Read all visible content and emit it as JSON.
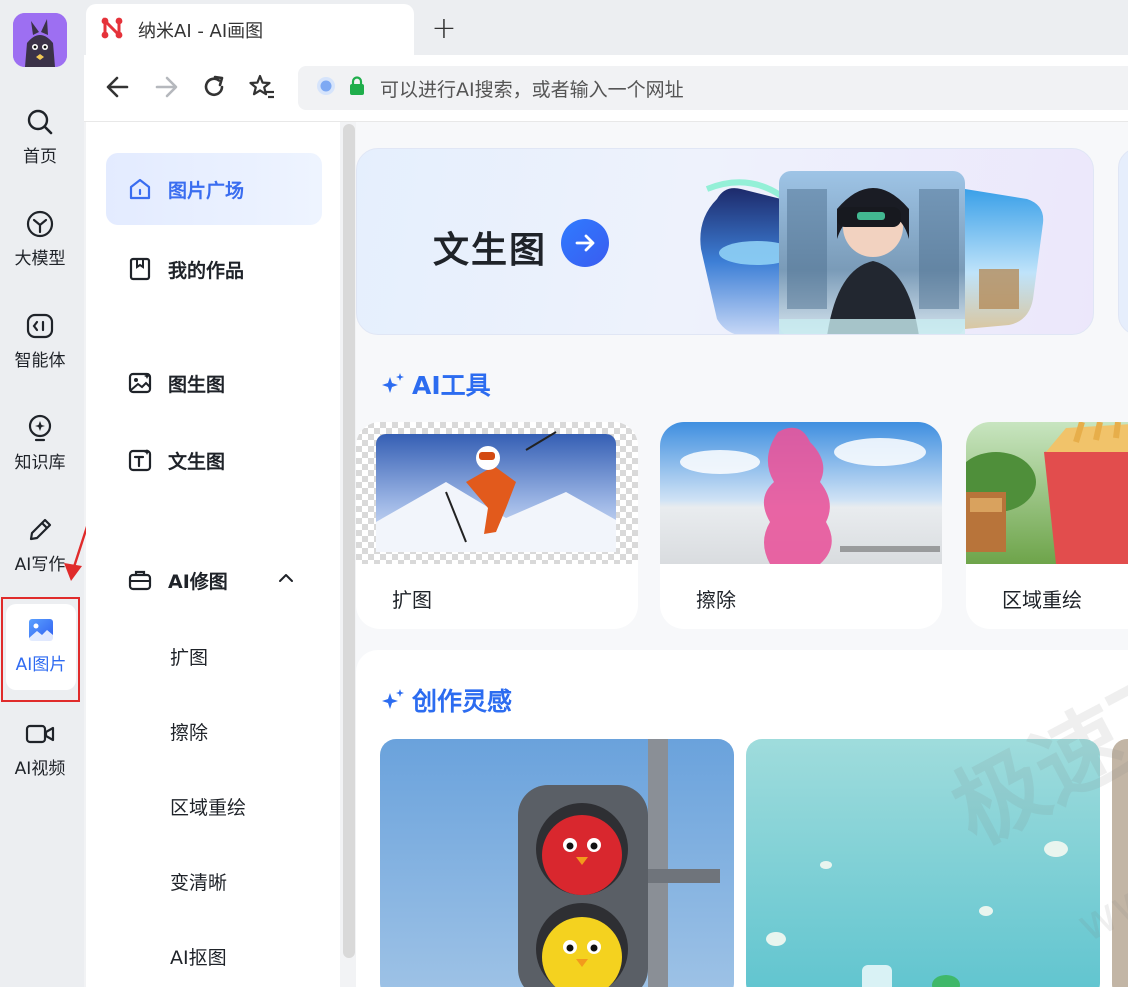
{
  "rail": {
    "items": [
      {
        "label": "首页",
        "icon": "search-icon"
      },
      {
        "label": "大模型",
        "icon": "hexagon-icon"
      },
      {
        "label": "智能体",
        "icon": "agent-icon"
      },
      {
        "label": "知识库",
        "icon": "bulb-icon"
      },
      {
        "label": "AI写作",
        "icon": "pencil-icon"
      },
      {
        "label": "AI图片",
        "icon": "image-icon",
        "active": true
      },
      {
        "label": "AI视频",
        "icon": "video-icon"
      }
    ]
  },
  "browser": {
    "tab_title": "纳米AI - AI画图",
    "new_tab": "+",
    "address_placeholder": "可以进行AI搜索，或者输入一个网址"
  },
  "sidenav": {
    "items": [
      {
        "label": "图片广场",
        "icon": "home-icon",
        "active": true
      },
      {
        "label": "我的作品",
        "icon": "bookmark-icon"
      },
      {
        "label": "图生图",
        "icon": "image-gen-icon"
      },
      {
        "label": "文生图",
        "icon": "text-image-icon"
      },
      {
        "label": "AI修图",
        "icon": "toolbox-icon",
        "expanded": true
      }
    ],
    "sub_items": [
      "扩图",
      "擦除",
      "区域重绘",
      "变清晰",
      "AI抠图"
    ]
  },
  "main": {
    "banner_title": "文生图",
    "tools_section": "AI工具",
    "tools": [
      "扩图",
      "擦除",
      "区域重绘"
    ],
    "inspiration_section": "创作灵感"
  },
  "watermark": "极速下载",
  "watermark_url": "www.jsydown.com",
  "colors": {
    "accent": "#2f6bf2",
    "highlight_box": "#e02b2b"
  }
}
